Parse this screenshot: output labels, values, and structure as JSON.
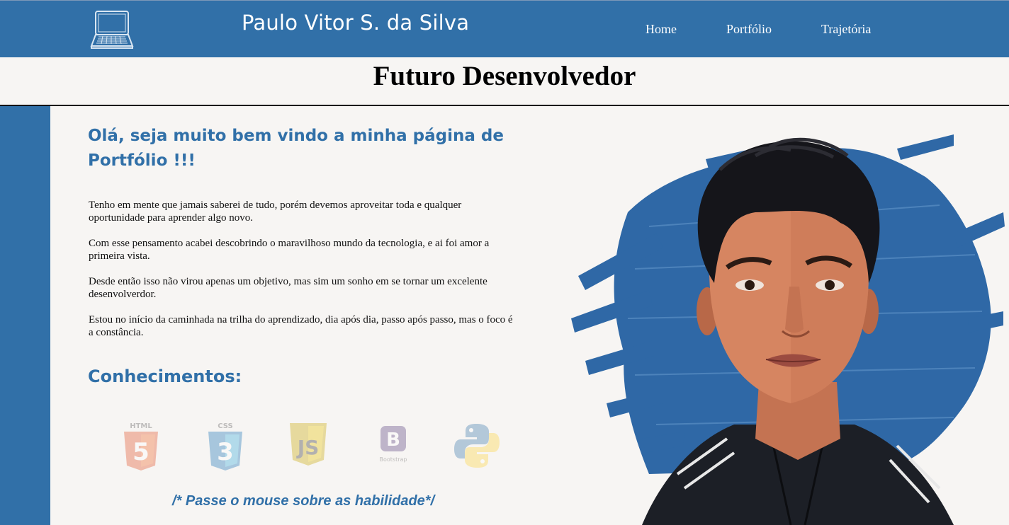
{
  "header": {
    "logo_icon": "laptop-icon",
    "title": "Paulo Vitor S. da Silva",
    "nav": [
      "Home",
      "Portfólio",
      "Trajetória"
    ]
  },
  "subheader": {
    "title": "Futuro Desenvolvedor"
  },
  "main": {
    "welcome": "Olá, seja muito bem vindo a minha página de Portfólio !!!",
    "paragraphs": [
      "Tenho em mente que jamais saberei de tudo, porém devemos aproveitar toda e qualquer oportunidade para aprender algo novo.",
      "Com esse pensamento acabei descobrindo o maravilhoso mundo da tecnologia, e ai foi amor a primeira vista.",
      "Desde então isso não virou apenas um objetivo, mas sim um sonho em se tornar um excelente desenvolverdor.",
      "Estou no início da caminhada na trilha do aprendizado, dia após dia, passo após passo, mas o foco é a constância."
    ],
    "skills_heading": "Conhecimentos:",
    "skills": [
      {
        "icon": "html5-icon",
        "label": "HTML",
        "glyph": "5"
      },
      {
        "icon": "css3-icon",
        "label": "CSS",
        "glyph": "3"
      },
      {
        "icon": "javascript-icon",
        "glyph": "JS"
      },
      {
        "icon": "bootstrap-icon",
        "glyph": "B",
        "label": "Bootstrap"
      },
      {
        "icon": "python-icon"
      }
    ],
    "hover_hint": "/* Passe o mouse sobre as habilidade*/"
  },
  "colors": {
    "brand_blue": "#3170a8",
    "background": "#f7f5f3",
    "html_orange": "#e34f26",
    "css_blue": "#1572b6",
    "js_yellow": "#c9a800",
    "bootstrap_purple": "#563d7c",
    "python_blue": "#3776ab",
    "python_yellow": "#ffd43b"
  }
}
